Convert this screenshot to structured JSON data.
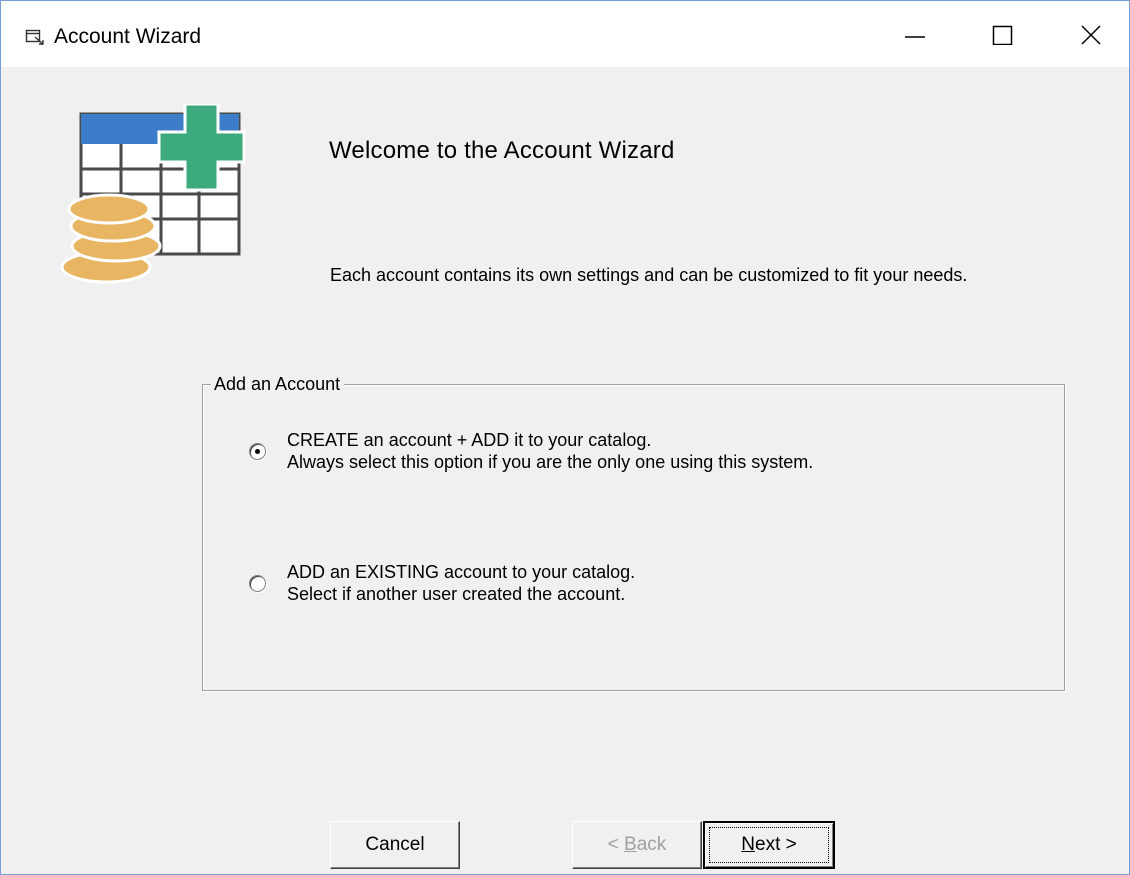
{
  "window": {
    "title": "Account Wizard",
    "title_icon": "wizard-window-icon",
    "controls": [
      "minimize-icon",
      "maximize-icon",
      "close-icon"
    ]
  },
  "header": {
    "logo_icon": "spreadsheet-coins-plus-icon",
    "title": "Welcome to the Account Wizard",
    "intro": "Each account contains its own settings and can be customized to fit your needs."
  },
  "group": {
    "legend": "Add an Account",
    "options": [
      {
        "line1": "CREATE an account + ADD it to your catalog.",
        "line2": "Always select this option if you are the only one using this system.",
        "selected": true
      },
      {
        "line1": "ADD an EXISTING account to your catalog.",
        "line2": "Select if another user created the account.",
        "selected": false
      }
    ]
  },
  "buttons": {
    "cancel": "Cancel",
    "back_prefix": "< ",
    "back_key": "B",
    "back_rest": "ack",
    "next_key": "N",
    "next_rest": "ext >"
  },
  "colors": {
    "logo_blue": "#3d7cc9",
    "logo_green": "#3daa7e",
    "coin_gold": "#e8b562"
  }
}
